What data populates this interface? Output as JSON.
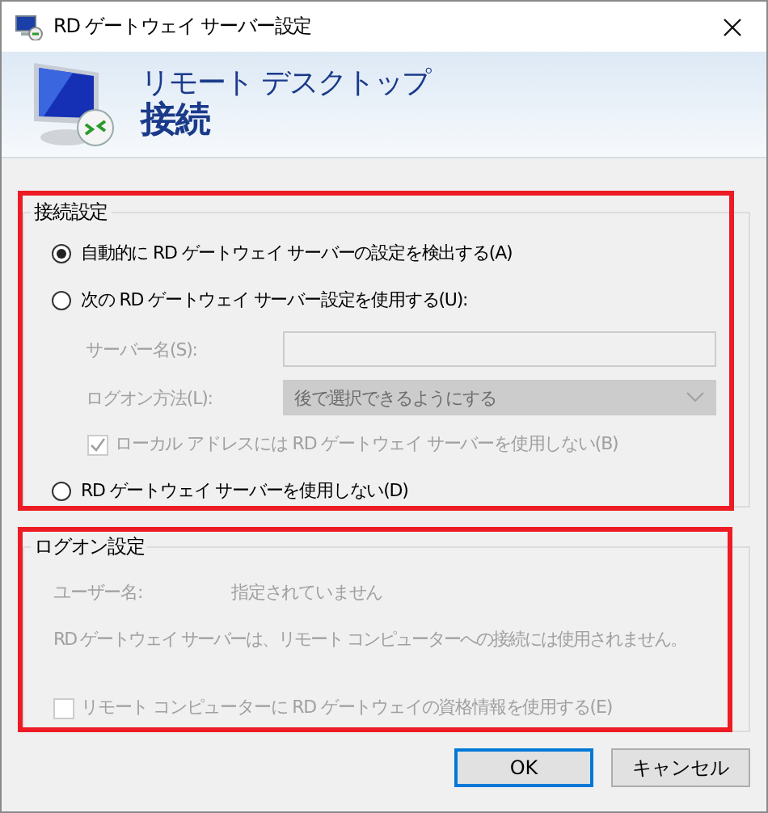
{
  "window": {
    "title": "RD ゲートウェイ サーバー設定"
  },
  "header": {
    "subtitle": "リモート デスクトップ",
    "title": "接続"
  },
  "connection_group": {
    "title": "接続設定",
    "highlighted": true,
    "options": [
      {
        "kind": "radio",
        "label": "自動的に RD ゲートウェイ サーバーの設定を検出する(A)",
        "selected": true
      },
      {
        "kind": "radio",
        "label": "次の RD ゲートウェイ サーバー設定を使用する(U):",
        "selected": false
      },
      {
        "kind": "field",
        "label": "サーバー名(S):",
        "disabled": true
      },
      {
        "kind": "dropdown",
        "label": "ログオン方法(L):",
        "value": "後で選択できるようにする",
        "disabled": true
      },
      {
        "kind": "checkbox",
        "label": "ローカル アドレスには RD ゲートウェイ サーバーを使用しない(B)",
        "checked": true,
        "disabled": true
      },
      {
        "kind": "radio",
        "label": "RD ゲートウェイ サーバーを使用しない(D)",
        "selected": false
      }
    ]
  },
  "logon_group": {
    "title": "ログオン設定",
    "highlighted": true,
    "user_label": "ユーザー名:",
    "user_value": "指定されていません",
    "note": "RD ゲートウェイ サーバーは、リモート コンピューターへの接続には使用されません。",
    "checkbox": {
      "label": "リモート コンピューターに RD ゲートウェイの資格情報を使用する(E)",
      "checked": false,
      "disabled": true
    }
  },
  "buttons": [
    {
      "label": "OK",
      "default": true
    },
    {
      "label": "キャンセル",
      "default": false
    }
  ]
}
